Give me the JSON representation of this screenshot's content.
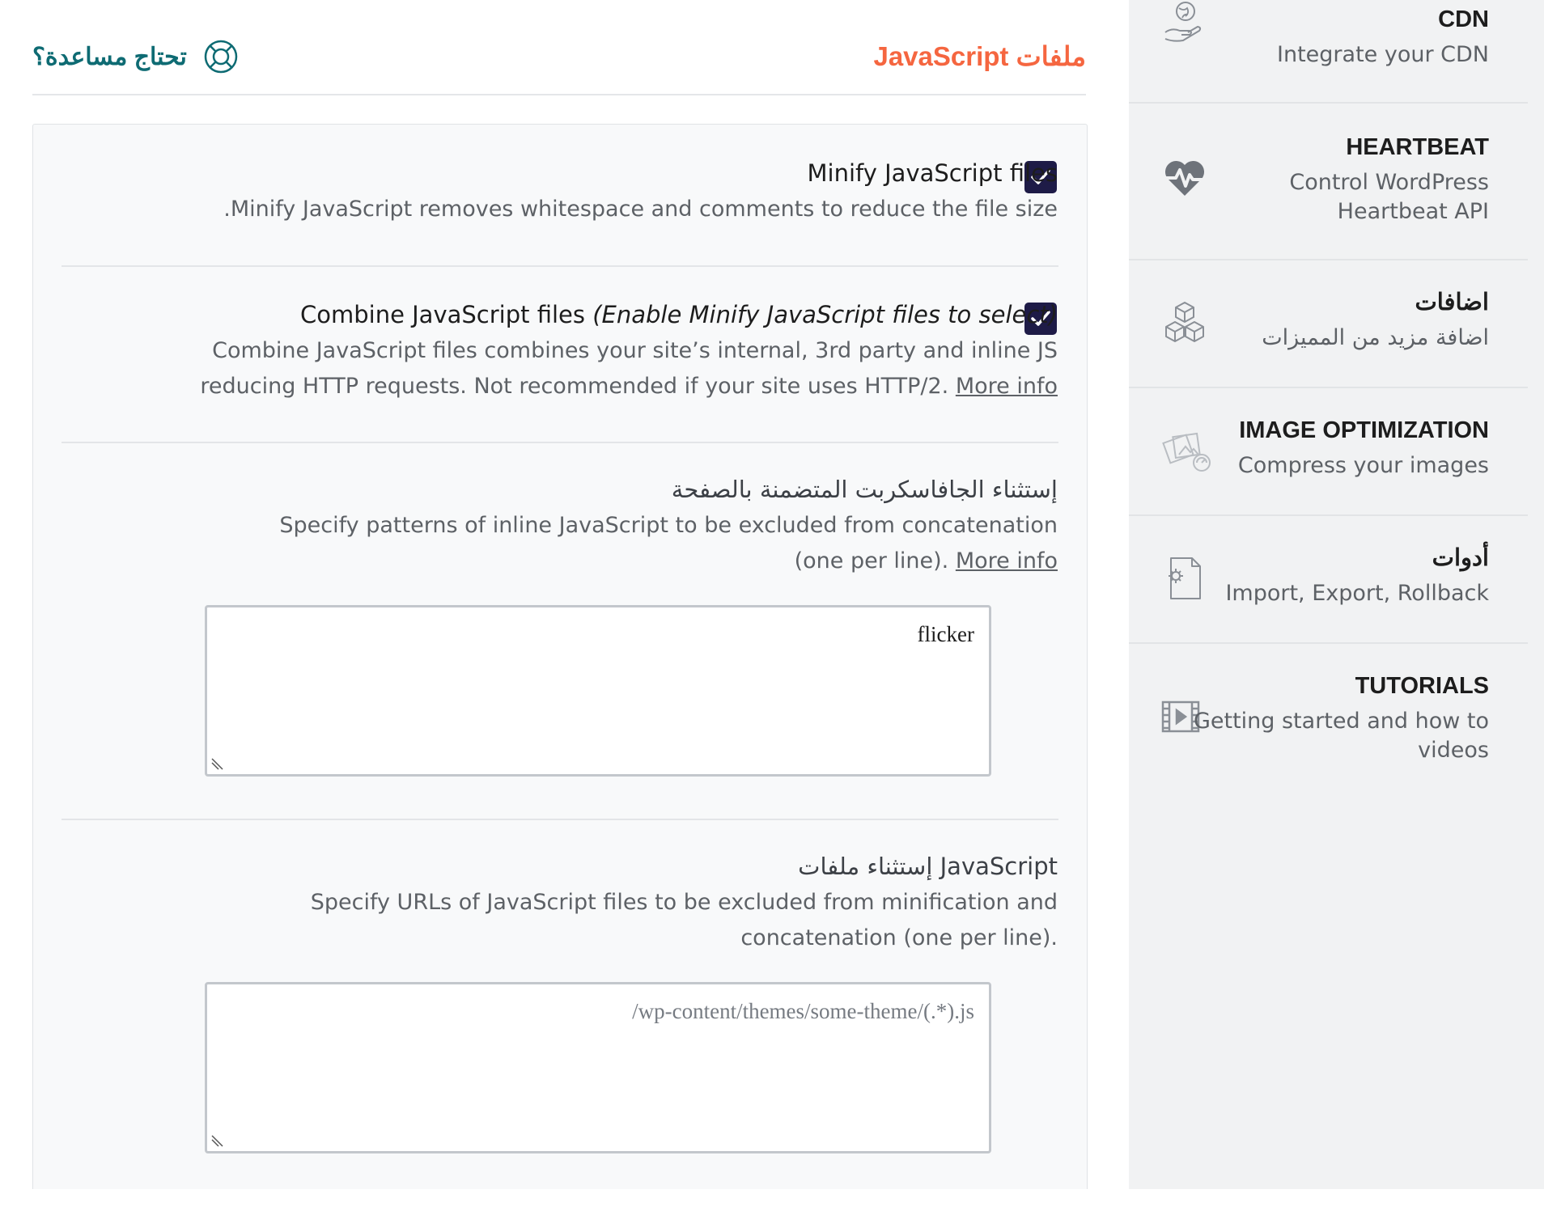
{
  "header": {
    "title": "ملفات JavaScript",
    "help_label": "تحتاج مساعدة؟"
  },
  "options": {
    "minify": {
      "title": "Minify JavaScript files",
      "description": ".Minify JavaScript removes whitespace and comments to reduce the file size",
      "checked": true
    },
    "combine": {
      "title": "Combine JavaScript files",
      "title_note": "(Enable Minify JavaScript files to select)",
      "description": "Combine JavaScript files combines your site’s internal, 3rd party and inline JS reducing HTTP requests. Not recommended if your site uses HTTP/2.",
      "more_info": "More info",
      "checked": true
    },
    "inline_exclude": {
      "title": "إستثناء الجافاسكربت المتضمنة بالصفحة",
      "description": "Specify patterns of inline JavaScript to be excluded from concatenation (one per line).",
      "more_info": "More info",
      "value": "flicker"
    },
    "files_exclude": {
      "title": "إستثناء ملفات JavaScript",
      "description": "Specify URLs of JavaScript files to be excluded from minification and concatenation (one per line).",
      "placeholder": "/wp-content/themes/some-theme/(.*).js"
    }
  },
  "sidebar": {
    "items": [
      {
        "title": "CDN",
        "description": "Integrate your CDN",
        "icon": "cdn-globe-hand-icon"
      },
      {
        "title": "HEARTBEAT",
        "description": "Control WordPress Heartbeat API",
        "icon": "heartbeat-icon"
      },
      {
        "title": "اضافات",
        "description": "اضافة مزيد من المميزات",
        "icon": "addons-cubes-icon"
      },
      {
        "title": "IMAGE OPTIMIZATION",
        "description": "Compress your images",
        "icon": "image-optimization-icon"
      },
      {
        "title": "أدوات",
        "description": "Import, Export, Rollback",
        "icon": "tools-gear-file-icon"
      },
      {
        "title": "TUTORIALS",
        "description": "Getting started and how to videos",
        "icon": "video-play-icon"
      }
    ]
  },
  "colors": {
    "accent_orange": "#f56640",
    "help_teal": "#0e6b73",
    "checkbox_navy": "#1e1b47",
    "sidebar_bg": "#f1f2f3"
  }
}
